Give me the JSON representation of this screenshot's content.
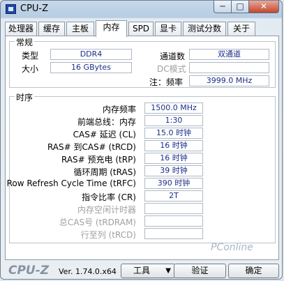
{
  "window": {
    "title": "CPU-Z",
    "min": "─",
    "max": "□",
    "close": "✕"
  },
  "tabs": [
    "处理器",
    "缓存",
    "主板",
    "内存",
    "SPD",
    "显卡",
    "测试分数",
    "关于"
  ],
  "general": {
    "title": "常规",
    "type_label": "类型",
    "type_value": "DDR4",
    "size_label": "大小",
    "size_value": "16 GBytes",
    "channels_label": "通道数",
    "channels_value": "双通道",
    "dc_label": "DC模式",
    "dc_value": "",
    "freq_label": "注：频率",
    "freq_value": "3999.0 MHz"
  },
  "timings": {
    "title": "时序",
    "rows": [
      {
        "label": "内存频率",
        "value": "1500.0 MHz"
      },
      {
        "label": "前端总线：内存",
        "value": "1:30"
      },
      {
        "label": "CAS# 延迟 (CL)",
        "value": "15.0 时钟"
      },
      {
        "label": "RAS# 到CAS# (tRCD)",
        "value": "16 时钟"
      },
      {
        "label": "RAS# 预充电 (tRP)",
        "value": "16 时钟"
      },
      {
        "label": "循环周期 (tRAS)",
        "value": "39 时钟"
      },
      {
        "label": "Row Refresh Cycle Time (tRFC)",
        "value": "390 时钟"
      },
      {
        "label": "指令比率 (CR)",
        "value": "2T"
      },
      {
        "label": "内存空闲计时器",
        "value": ""
      },
      {
        "label": "总CAS号 (tRDRAM)",
        "value": ""
      },
      {
        "label": "行至列 (tRCD)",
        "value": ""
      }
    ]
  },
  "footer": {
    "logo": "CPU-Z",
    "version": "Ver. 1.74.0.x64",
    "tools": "工具",
    "validate": "验证",
    "ok": "确定"
  },
  "watermark": "PConline"
}
